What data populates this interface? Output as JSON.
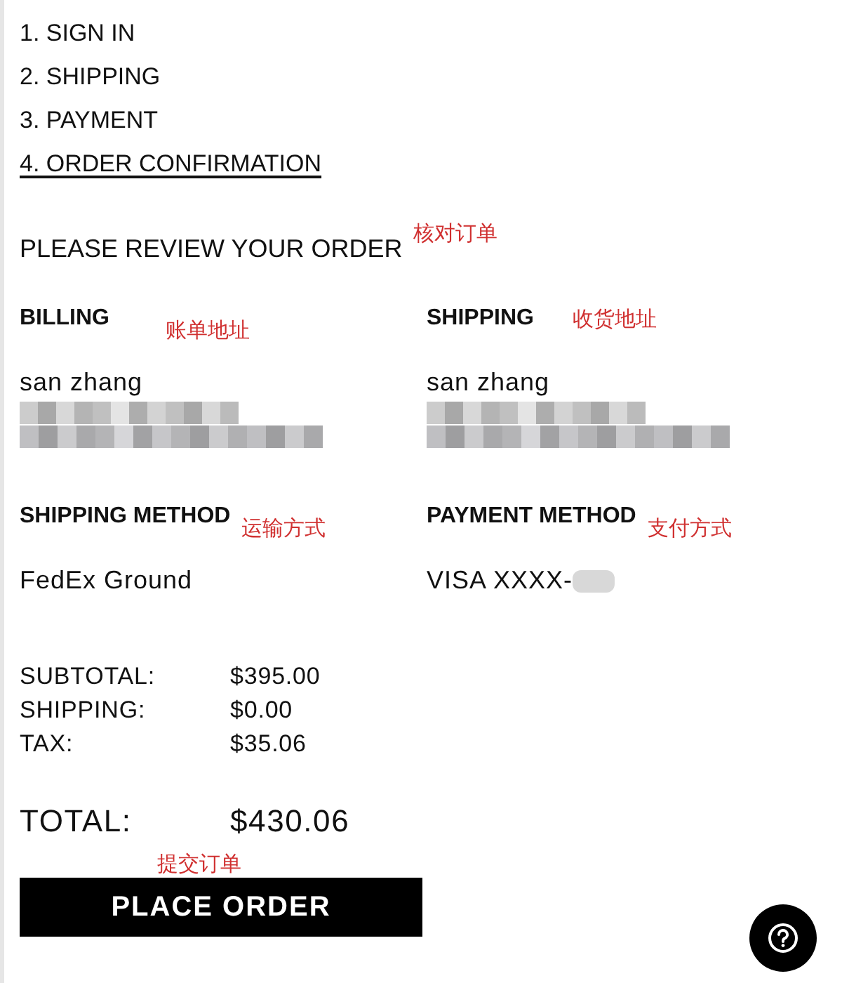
{
  "steps": [
    {
      "label": "1. SIGN IN",
      "selected": false
    },
    {
      "label": "2. SHIPPING",
      "selected": false
    },
    {
      "label": "3. PAYMENT",
      "selected": false
    },
    {
      "label": "4. ORDER CONFIRMATION",
      "selected": true
    }
  ],
  "review": {
    "heading": "PLEASE REVIEW YOUR ORDER",
    "note": "核对订单"
  },
  "sections": [
    {
      "heading": "BILLING",
      "note": "账单地址",
      "lines": [
        {
          "kind": "text",
          "text": "san zhang"
        },
        {
          "kind": "redacted"
        }
      ]
    },
    {
      "heading": "SHIPPING",
      "note": "收货地址",
      "lines": [
        {
          "kind": "text",
          "text": "san zhang"
        },
        {
          "kind": "redacted"
        }
      ]
    },
    {
      "heading": "SHIPPING METHOD",
      "note": "运输方式",
      "lines": [
        {
          "kind": "text",
          "text": "FedEx Ground"
        }
      ]
    },
    {
      "heading": "PAYMENT METHOD",
      "note": "支付方式",
      "lines": [
        {
          "kind": "card",
          "text": "VISA XXXX-"
        }
      ]
    }
  ],
  "summary": [
    {
      "label": "SUBTOTAL:",
      "value": "$395.00"
    },
    {
      "label": "SHIPPING:",
      "value": "$0.00"
    },
    {
      "label": "TAX:",
      "value": "$35.06"
    }
  ],
  "total": {
    "label": "TOTAL:",
    "value": "$430.06"
  },
  "place_order": {
    "note": "提交订单",
    "label": "PLACE ORDER"
  }
}
